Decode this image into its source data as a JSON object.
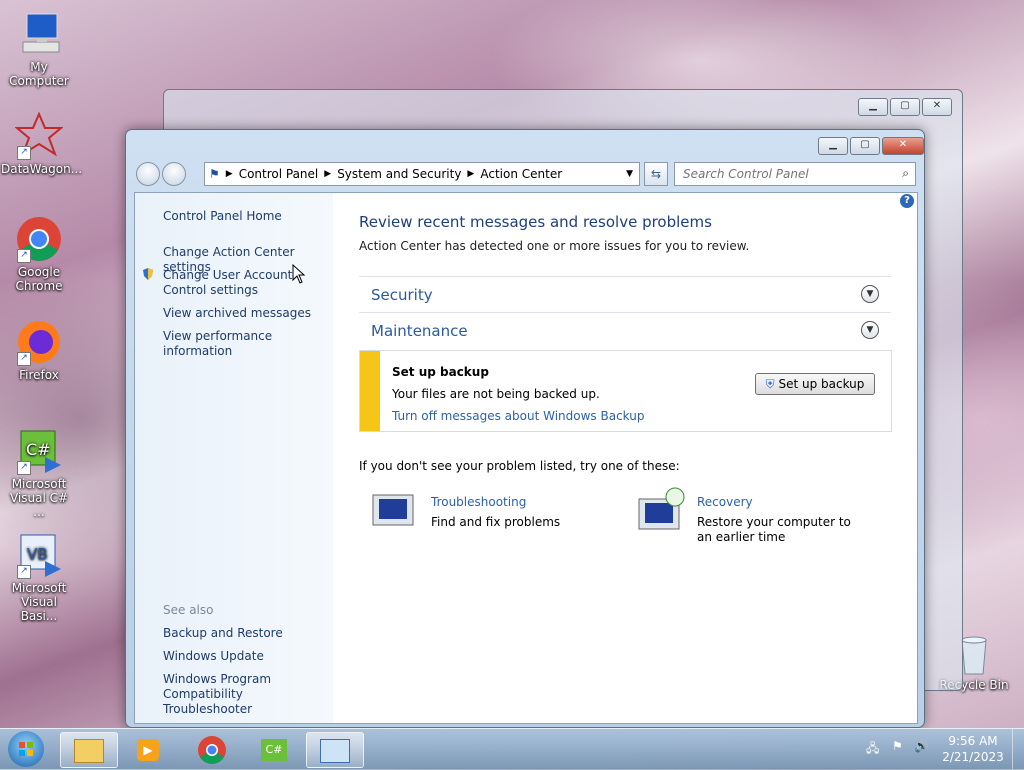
{
  "desktop": {
    "icons": [
      {
        "label": "My Computer"
      },
      {
        "label": "DataWagon..."
      },
      {
        "label": "Google Chrome"
      },
      {
        "label": "Firefox"
      },
      {
        "label": "Microsoft Visual C# ..."
      },
      {
        "label": "Microsoft Visual Basi..."
      },
      {
        "label": "Recycle Bin"
      }
    ]
  },
  "window": {
    "breadcrumb": [
      "Control Panel",
      "System and Security",
      "Action Center"
    ],
    "search_placeholder": "Search Control Panel",
    "sidebar": {
      "home": "Control Panel Home",
      "links": [
        "Change Action Center settings",
        "Change User Account Control settings",
        "View archived messages",
        "View performance information"
      ],
      "see_also_title": "See also",
      "see_also": [
        "Backup and Restore",
        "Windows Update",
        "Windows Program Compatibility Troubleshooter"
      ]
    },
    "main": {
      "title": "Review recent messages and resolve problems",
      "subtitle": "Action Center has detected one or more issues for you to review.",
      "sections": [
        "Security",
        "Maintenance"
      ],
      "message": {
        "title": "Set up backup",
        "text": "Your files are not being backed up.",
        "link": "Turn off messages about Windows Backup",
        "button": "Set up backup"
      },
      "try_text": "If you don't see your problem listed, try one of these:",
      "tools": [
        {
          "title": "Troubleshooting",
          "desc": "Find and fix problems"
        },
        {
          "title": "Recovery",
          "desc": "Restore your computer to an earlier time"
        }
      ]
    }
  },
  "taskbar": {
    "time": "9:56 AM",
    "date": "2/21/2023"
  },
  "colors": {
    "accent": "#2b5a9a",
    "warning": "#f5c518"
  }
}
